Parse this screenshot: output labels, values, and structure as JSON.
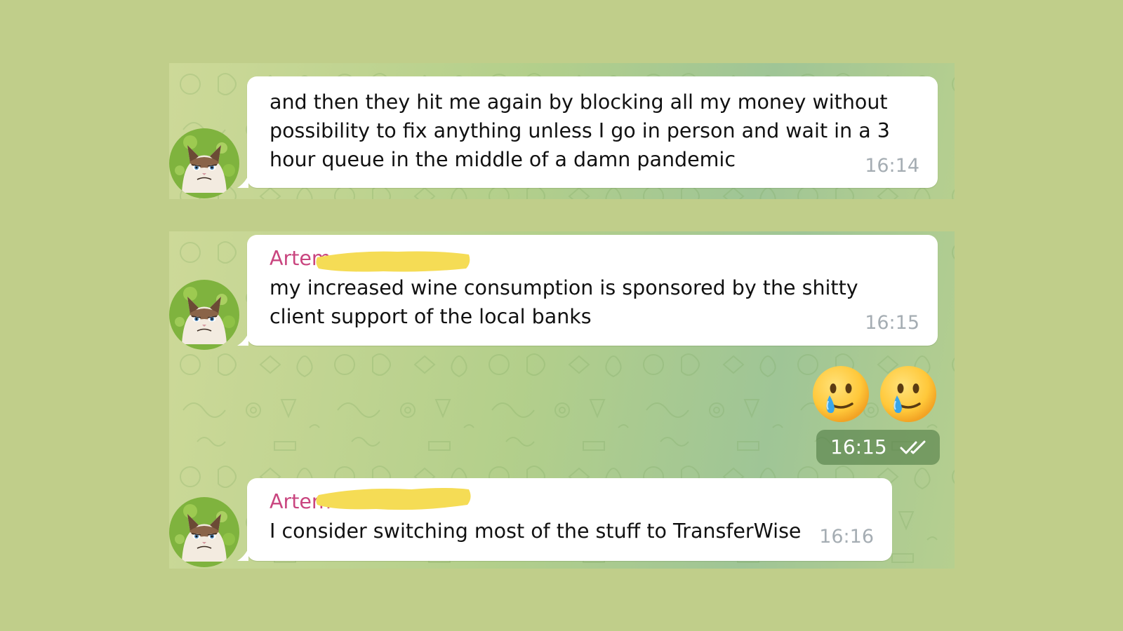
{
  "messages": [
    {
      "sender": "",
      "text_lines": [
        "and then they hit me again by blocking all my money without",
        "possibility to fix anything unless I go in person and wait in a 3",
        "hour queue in the middle of a damn pandemic"
      ],
      "time": "16:14"
    },
    {
      "sender": "Artem",
      "text_lines": [
        "my increased wine consumption is sponsored by the shitty",
        "client support of the local banks"
      ],
      "time": "16:15"
    },
    {
      "sender": "Artem",
      "text_lines": [
        "I consider switching most of the stuff to TransferWise"
      ],
      "time": "16:16"
    }
  ],
  "outgoing_sticker": {
    "emoji": [
      "🥲",
      "🥲"
    ],
    "time": "16:15",
    "status_icon": "double-check-icon"
  },
  "colors": {
    "page_background": "#c0ce8a",
    "sender_name": "#c9457f",
    "time_text": "#a5adb3",
    "redaction_marker": "#f5dc55",
    "outgoing_meta_bg": "#5a8450"
  }
}
